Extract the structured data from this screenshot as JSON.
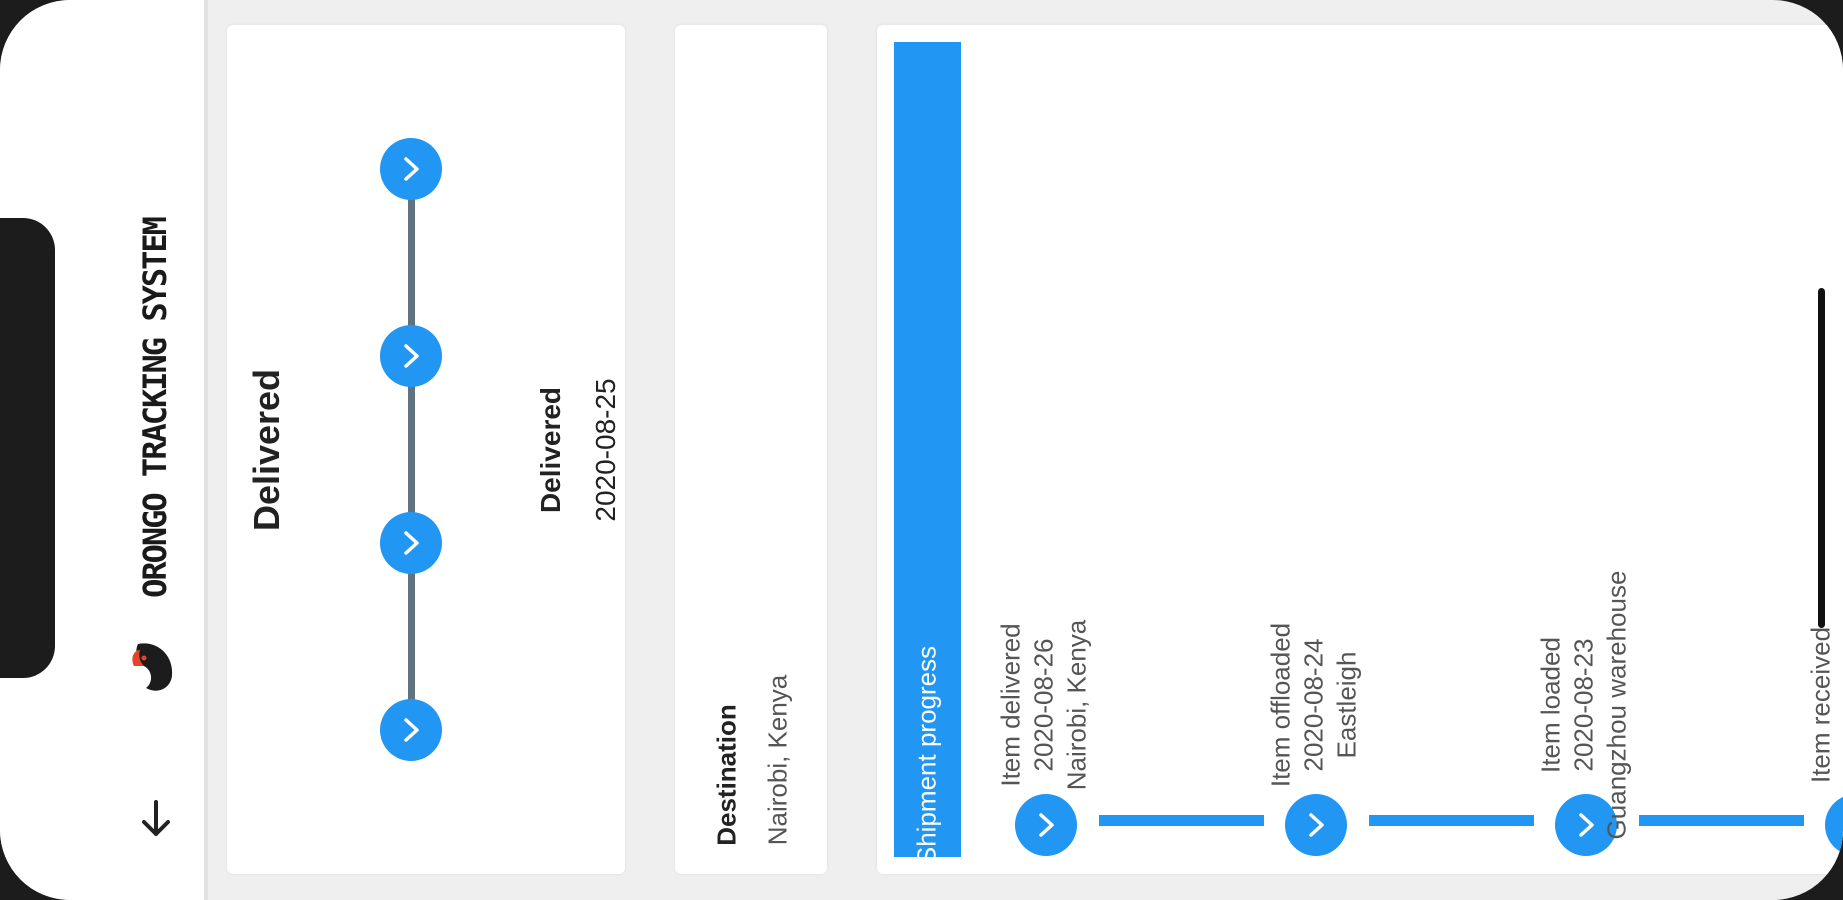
{
  "app": {
    "title": "ORONGO TRACKING SYSTEM",
    "back_icon": "arrow-back-icon",
    "logo_icon": "bird-logo-icon"
  },
  "status": {
    "title": "Delivered",
    "steps": 4,
    "current_label": "Delivered",
    "current_date": "2020-08-25"
  },
  "destination": {
    "label": "Destination",
    "value": "Nairobi, Kenya"
  },
  "progress": {
    "header": "Shipment progress",
    "events": [
      {
        "title": "Item delivered",
        "date": "2020-08-26",
        "place": "Nairobi, Kenya"
      },
      {
        "title": "Item offloaded",
        "date": "2020-08-24",
        "place": "Eastleigh"
      },
      {
        "title": "Item loaded",
        "date": "2020-08-23",
        "place": "Guangzhou warehouse"
      },
      {
        "title": "Item received",
        "date": "",
        "place": ""
      }
    ]
  },
  "colors": {
    "accent": "#2196f3",
    "connector": "#5f7380",
    "background": "#efefef"
  }
}
